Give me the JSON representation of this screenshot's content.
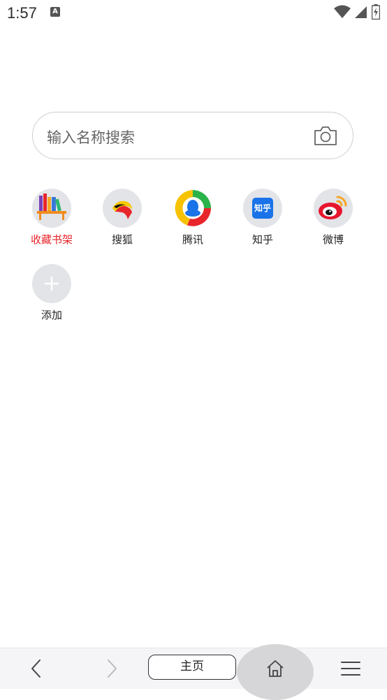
{
  "status_bar": {
    "time": "1:57",
    "notification_badge": "A"
  },
  "search": {
    "placeholder": "输入名称搜索"
  },
  "shortcuts": [
    {
      "label": "收藏书架",
      "icon": "bookshelf-icon",
      "color": "#e8252a"
    },
    {
      "label": "搜狐",
      "icon": "sohu-icon"
    },
    {
      "label": "腾讯",
      "icon": "tencent-icon"
    },
    {
      "label": "知乎",
      "icon": "zhihu-icon",
      "icon_text": "知乎"
    },
    {
      "label": "微博",
      "icon": "weibo-icon"
    }
  ],
  "add_tile": {
    "label": "添加",
    "icon": "plus-icon"
  },
  "bottom_nav": {
    "back_icon": "back-arrow-icon",
    "forward_icon": "forward-arrow-icon",
    "homepage_label": "主页",
    "home_icon": "home-icon",
    "menu_icon": "menu-icon"
  },
  "colors": {
    "accent_red": "#e8252a",
    "zhihu_blue": "#1a73e8",
    "tile_bg": "#e2e4e8"
  }
}
